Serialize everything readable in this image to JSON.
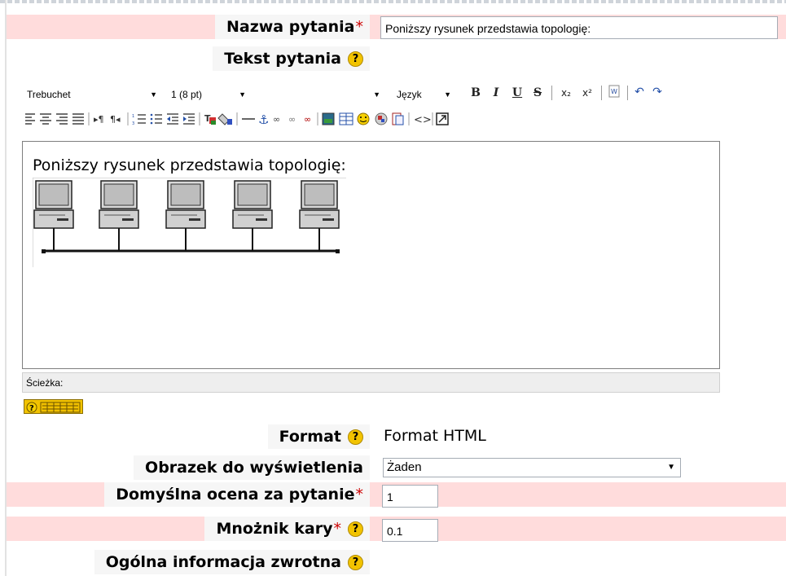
{
  "question_name": {
    "label": "Nazwa pytania",
    "required_marker": "*",
    "value": "Poniższy rysunek przedstawia topologię:"
  },
  "question_text": {
    "label": "Tekst pytania",
    "help_icon": "help-icon"
  },
  "editor": {
    "font_family": "Trebuchet",
    "font_size": "1 (8 pt)",
    "heading_value": "",
    "language": "Język",
    "toolbar_row1": {
      "bold": "B",
      "italic": "I",
      "underline": "U",
      "strike": "S",
      "subscript": "x₂",
      "superscript": "x²",
      "undo": "↶",
      "redo": "↷"
    },
    "toolbar_row2_icons": [
      "align-left-icon",
      "align-center-icon",
      "align-right-icon",
      "justify-icon",
      "ltr-icon",
      "rtl-icon",
      "ordered-list-icon",
      "unordered-list-icon",
      "outdent-icon",
      "indent-icon",
      "text-color-icon",
      "background-color-icon",
      "horizontal-rule-icon",
      "anchor-icon",
      "link-icon",
      "unlink-icon",
      "nolink-icon",
      "insert-image-icon",
      "insert-table-icon",
      "smiley-icon",
      "special-char-icon",
      "paste-word-icon",
      "html-source-icon",
      "fullscreen-icon"
    ],
    "content_text": "Poniższy rysunek przedstawia topologię:",
    "image_icon": "bus-topology-diagram",
    "path_label": "Ścieżka:"
  },
  "format": {
    "label": "Format",
    "value": "Format HTML"
  },
  "image_to_display": {
    "label": "Obrazek do wyświetlenia",
    "value": "Żaden"
  },
  "default_grade": {
    "label": "Domyślna ocena za pytanie",
    "required_marker": "*",
    "value": "1"
  },
  "penalty_factor": {
    "label": "Mnożnik kary",
    "required_marker": "*",
    "value": "0.1"
  },
  "general_feedback": {
    "label": "Ogólna informacja zwrotna"
  },
  "colors": {
    "required_row_bg": "#ffdcdc",
    "required_star": "#cc0000",
    "help_icon": "#f2c300"
  }
}
